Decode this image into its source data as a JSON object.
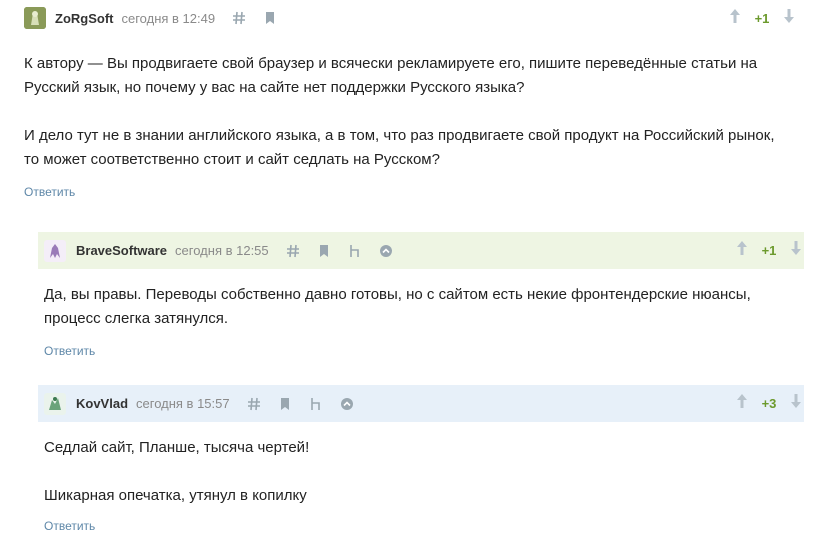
{
  "comments": [
    {
      "username": "ZoRgSoft",
      "time": "сегодня в 12:49",
      "score": "+1",
      "body": [
        "К автору — Вы продвигаете свой браузер и всячески рекламируете его, пишите переведённые статьи на Русский язык, но почему у вас на сайте нет поддержки Русского языка?",
        "И дело тут не в знании английского языка, а в том, что раз продвигаете свой продукт на Российский рынок, то может соответственно стоит и сайт седлать на Русском?"
      ],
      "reply": "Ответить",
      "avatar_color": "#7d8f4a"
    },
    {
      "username": "BraveSoftware",
      "time": "сегодня в 12:55",
      "score": "+1",
      "body": [
        "Да, вы правы. Переводы собственно давно готовы, но с сайтом есть некие фронтендерские нюансы, процесс слегка затянулся."
      ],
      "reply": "Ответить",
      "avatar_color": "#9a7bb8"
    },
    {
      "username": "KovVlad",
      "time": "сегодня в 15:57",
      "score": "+3",
      "body": [
        "Седлай сайт, Планше, тысяча чертей!",
        "Шикарная опечатка, утянул в копилку"
      ],
      "reply": "Ответить",
      "avatar_color": "#6aa37a"
    }
  ],
  "icons": {
    "link": "hash-icon",
    "bookmark": "bookmark-icon",
    "parent": "parent-link-icon",
    "collapse": "collapse-icon",
    "upvote": "arrow-up-icon",
    "downvote": "arrow-down-icon"
  },
  "colors": {
    "author_bg": "#eef5e3",
    "new_bg": "#e7f0f9",
    "score_green": "#6c9a2d",
    "reply_link": "#5e87a8"
  }
}
